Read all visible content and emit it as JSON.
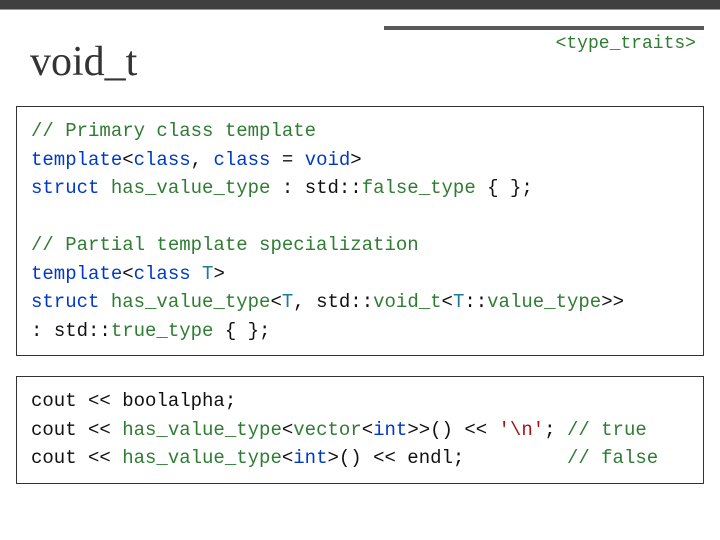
{
  "header": {
    "tag": "<type_traits>",
    "title": "void_t"
  },
  "box1": {
    "c1": "// Primary class template",
    "l2_kw1": "template",
    "l2_op1": "<",
    "l2_kw2": "class",
    "l2_op2": ", ",
    "l2_kw3": "class",
    "l2_op3": " = ",
    "l2_kw4": "void",
    "l2_op4": ">",
    "l3_kw1": "struct",
    "l3_sp": " ",
    "l3_typ": "has_value_type",
    "l3_op1": " : ",
    "l3_ns": "std::",
    "l3_typ2": "false_type",
    "l3_end": " { };",
    "c2": "// Partial template specialization",
    "l5_kw1": "template",
    "l5_op1": "<",
    "l5_kw2": "class",
    "l5_sp": " ",
    "l5_tpl": "T",
    "l5_op2": ">",
    "l6_kw1": "struct",
    "l6_sp": " ",
    "l6_typ": "has_value_type",
    "l6_op1": "<",
    "l6_tpl1": "T",
    "l6_op2": ", ",
    "l6_ns": "std::",
    "l6_typ2": "void_t",
    "l6_op3": "<",
    "l6_tpl2": "T",
    "l6_op4": "::",
    "l6_typ3": "value_type",
    "l6_op5": ">>",
    "l7_op1": ": ",
    "l7_ns": "std::",
    "l7_typ": "true_type",
    "l7_end": " { };"
  },
  "box2": {
    "l1_a": "cout << boolalpha;",
    "l2_a": "cout << ",
    "l2_typ": "has_value_type",
    "l2_op1": "<",
    "l2_typ2": "vector",
    "l2_op2": "<",
    "l2_kw": "int",
    "l2_op3": ">>() << ",
    "l2_str": "'\\n'",
    "l2_end": "; ",
    "l2_cmt": "// true",
    "l3_a": "cout << ",
    "l3_typ": "has_value_type",
    "l3_op1": "<",
    "l3_kw": "int",
    "l3_op2": ">() << endl;",
    "l3_pad": "         ",
    "l3_cmt": "// false"
  }
}
